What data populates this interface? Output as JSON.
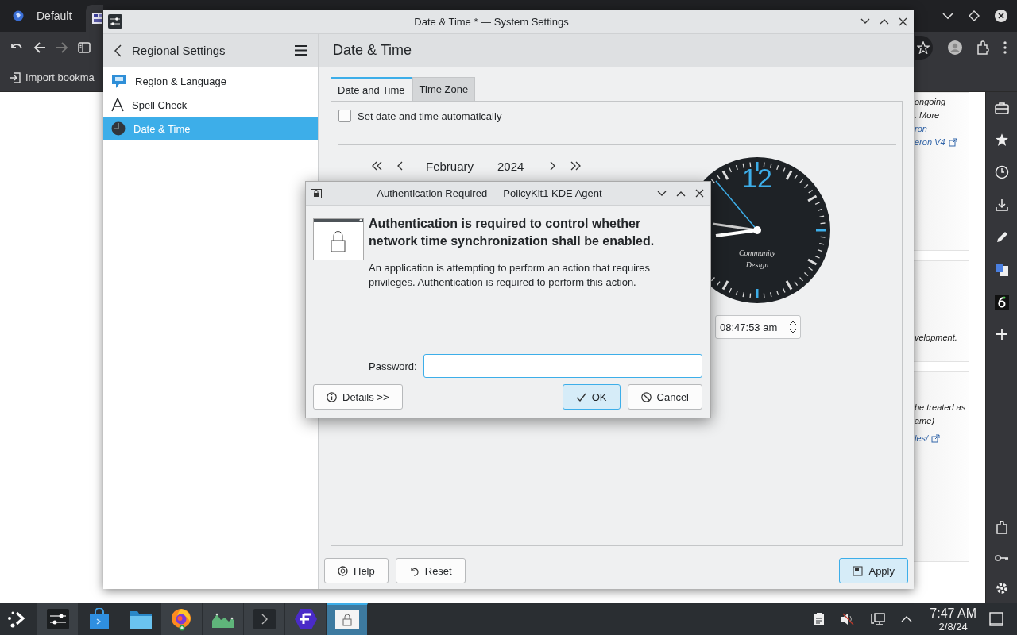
{
  "browser": {
    "tabs": [
      {
        "label": "Default",
        "selected": false
      },
      {
        "selected": true
      }
    ],
    "bookmarks": [
      {
        "label": "Import bookma"
      }
    ],
    "cards": [
      {
        "lines": [
          {
            "text": "ongoing",
            "kind": "text"
          },
          {
            "text": ". More",
            "kind": "text"
          },
          {
            "text": "ron",
            "kind": "link"
          },
          {
            "text": "eron V4",
            "kind": "external_link"
          }
        ]
      },
      {
        "lines": [
          {
            "text": "velopment.",
            "kind": "text"
          }
        ]
      },
      {
        "lines": [
          {
            "text": "be treated as",
            "kind": "text"
          },
          {
            "text": "ame)",
            "kind": "text"
          },
          {
            "text": "les/",
            "kind": "external_link"
          }
        ]
      }
    ]
  },
  "settings_window": {
    "title": "Date & Time * — System Settings",
    "sidebar": {
      "title": "Regional Settings",
      "items": [
        {
          "label": "Region & Language",
          "selected": false
        },
        {
          "label": "Spell Check",
          "selected": false
        },
        {
          "label": "Date & Time",
          "selected": true
        }
      ]
    },
    "page_title": "Date & Time",
    "tabs": [
      {
        "label": "Date and Time",
        "selected": true
      },
      {
        "label": "Time Zone",
        "selected": false
      }
    ],
    "auto_sync": {
      "label": "Set date and time automatically",
      "checked": false
    },
    "calendar": {
      "month": "February",
      "year": "2024"
    },
    "clock": {
      "hour_label": "12",
      "brand": [
        "Community",
        "Design"
      ]
    },
    "time": {
      "value": "08:47:53 am"
    },
    "buttons": [
      {
        "label": "Help",
        "default": false
      },
      {
        "label": "Reset",
        "default": false
      },
      {
        "label": "Apply",
        "default": true
      }
    ]
  },
  "auth_dialog": {
    "title": "Authentication Required — PolicyKit1 KDE Agent",
    "heading": "Authentication is required to control whether network time synchronization shall be enabled.",
    "message": "An application is attempting to perform an action that requires privileges. Authentication is required to perform this action.",
    "password_label": "Password:",
    "buttons": [
      {
        "label": "Details >>",
        "focused": false
      },
      {
        "label": "OK",
        "focused": true
      },
      {
        "label": "Cancel",
        "focused": false
      }
    ]
  },
  "taskbar": {
    "apps": [
      {
        "running": true,
        "selected": false
      },
      {
        "running": false,
        "selected": false
      },
      {
        "running": false,
        "selected": false
      },
      {
        "running": true,
        "selected": false
      },
      {
        "running": true,
        "selected": false
      },
      {
        "running": true,
        "selected": false
      },
      {
        "running": true,
        "selected": false
      },
      {
        "running": true,
        "selected": true
      }
    ],
    "clock": {
      "time": "7:47 AM",
      "date": "2/8/24"
    }
  }
}
